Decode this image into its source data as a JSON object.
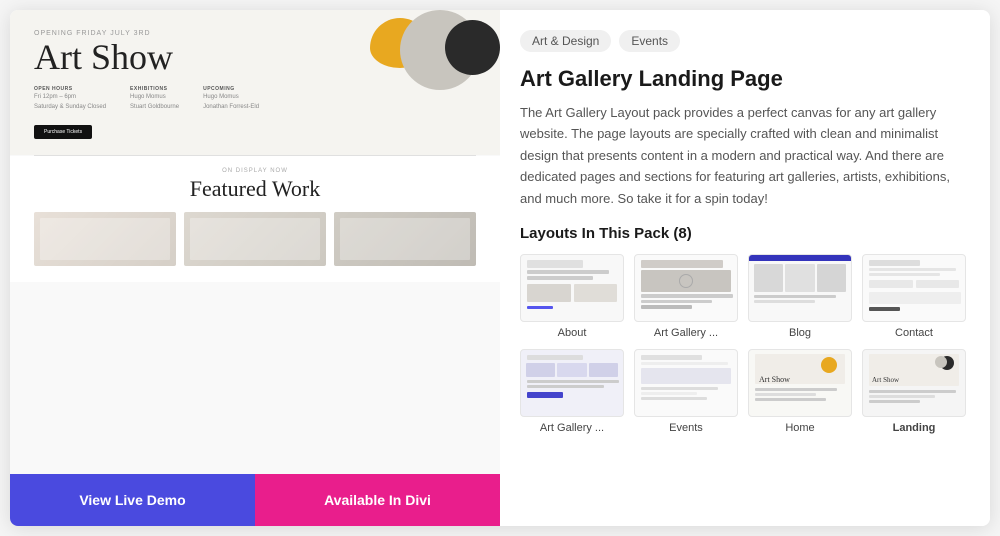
{
  "left_panel": {
    "mockup": {
      "subtitle": "Opening Friday July 3rd",
      "title": "Art Show",
      "open_hours_label": "Open Hours",
      "open_hours_value": "Fri 12pm - 6pm\nSaturday & Sunday Closed",
      "exhibitions_label": "Exhibitions",
      "exhibitions_value": "Hugo Momus\nStuart Goldbourne",
      "upcoming_label": "Upcoming",
      "upcoming_value": "Hugo Momus\nJonathan Forrest-Eld",
      "button_text": "Purchase Tickets",
      "featured_sub": "On Display Now",
      "featured_title": "Featured Work"
    },
    "buttons": {
      "demo_label": "View Live Demo",
      "divi_label": "Available In Divi"
    }
  },
  "right_panel": {
    "tags": [
      "Art & Design",
      "Events"
    ],
    "title": "Art Gallery Landing Page",
    "description": "The Art Gallery Layout pack provides a perfect canvas for any art gallery website. The page layouts are specially crafted with clean and minimalist design that presents content in a modern and practical way. And there are dedicated pages and sections for featuring art galleries, artists, exhibitions, and much more. So take it for a spin today!",
    "layouts_heading": "Layouts In This Pack (8)",
    "layouts": [
      {
        "label": "About",
        "type": "about"
      },
      {
        "label": "Art Gallery ...",
        "type": "gallery"
      },
      {
        "label": "Blog",
        "type": "blog"
      },
      {
        "label": "Contact",
        "type": "contact"
      },
      {
        "label": "Art Gallery ...",
        "type": "gallery2"
      },
      {
        "label": "Events",
        "type": "events"
      },
      {
        "label": "Home",
        "type": "home"
      },
      {
        "label": "Landing",
        "type": "landing",
        "bold": true
      }
    ]
  }
}
